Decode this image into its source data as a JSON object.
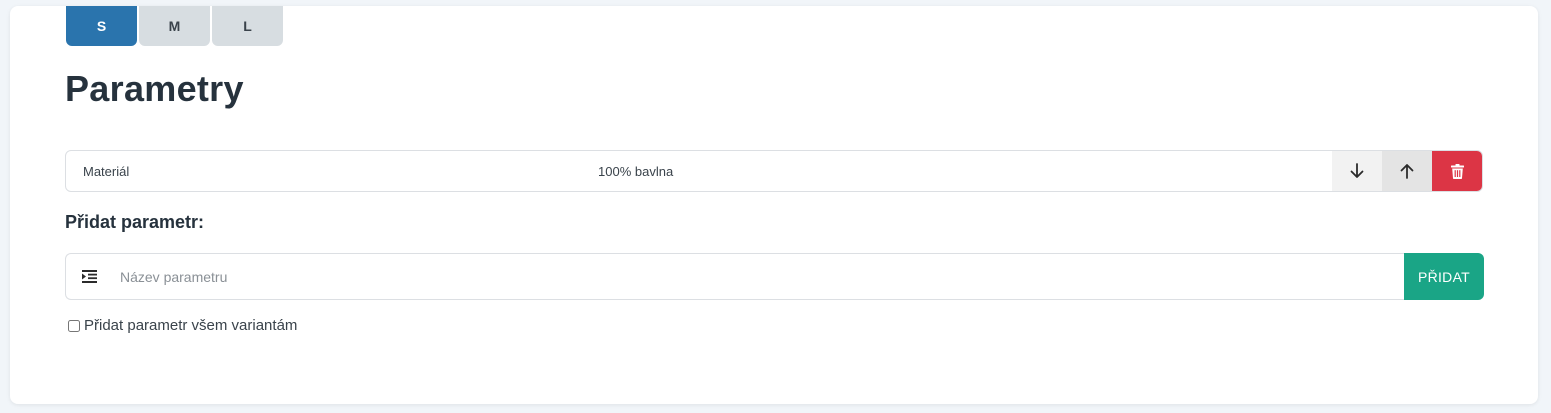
{
  "size_tabs": [
    {
      "label": "S",
      "active": true
    },
    {
      "label": "M",
      "active": false
    },
    {
      "label": "L",
      "active": false
    }
  ],
  "section": {
    "title": "Parametry"
  },
  "parameters": [
    {
      "name": "Materiál",
      "value": "100% bavlna"
    }
  ],
  "row_actions": {
    "move_down_icon": "arrow-down-icon",
    "move_up_icon": "arrow-up-icon",
    "delete_icon": "trash-icon"
  },
  "add_parameter": {
    "title": "Přidat parametr:",
    "input_icon": "indent-icon",
    "placeholder": "Název parametru",
    "value": "",
    "button_label": "PŘIDAT",
    "checkbox_label": "Přidat parametr všem variantám",
    "checkbox_checked": false
  },
  "colors": {
    "primary": "#2a74ad",
    "success": "#1aa586",
    "danger": "#dc3545",
    "tab_inactive": "#d7dde1"
  }
}
